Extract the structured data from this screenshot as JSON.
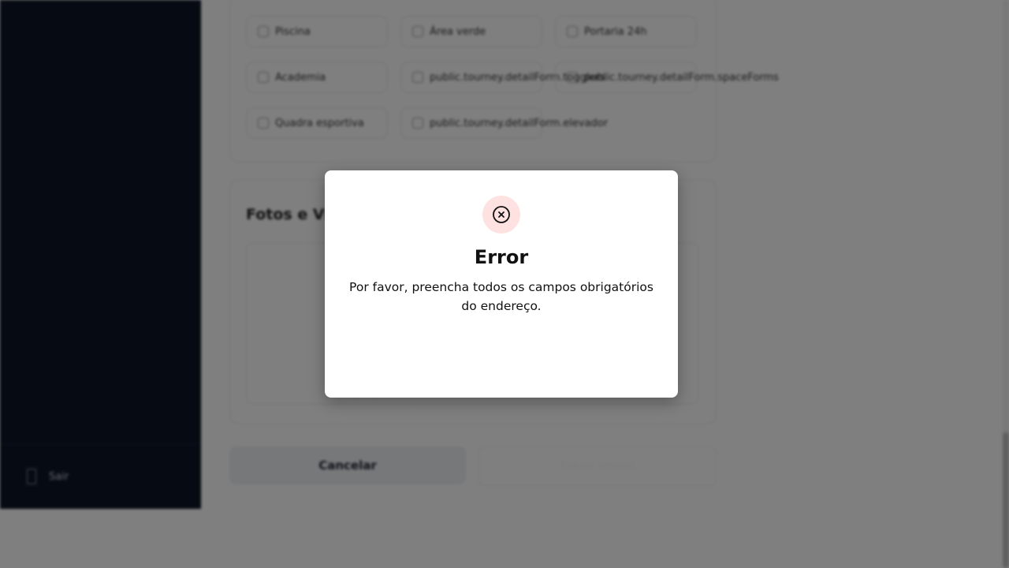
{
  "sidebar": {
    "logout_label": "Sair"
  },
  "amenities": [
    {
      "label": "Piscina"
    },
    {
      "label": "Área verde"
    },
    {
      "label": "Portaria 24h"
    },
    {
      "label": "Academia"
    },
    {
      "label": "public.tourney.detailForm.togglers"
    },
    {
      "label": "public.tourney.detailForm.spaceForms"
    },
    {
      "label": "Quadra esportiva"
    },
    {
      "label": "public.tourney.detailForm.elevador"
    }
  ],
  "media": {
    "title": "Fotos e Vídeos"
  },
  "actions": {
    "cancel_label": "Cancelar",
    "submit_label": "Salvar imóvel"
  },
  "modal": {
    "icon": "x-circle-icon",
    "title": "Error",
    "message": "Por favor, preencha todos os campos obrigatórios do endereço."
  },
  "colors": {
    "sidebar_bg": "#0d1526",
    "icon_bg": "#fee2e2",
    "overlay": "rgba(0,0,0,0.5)"
  }
}
